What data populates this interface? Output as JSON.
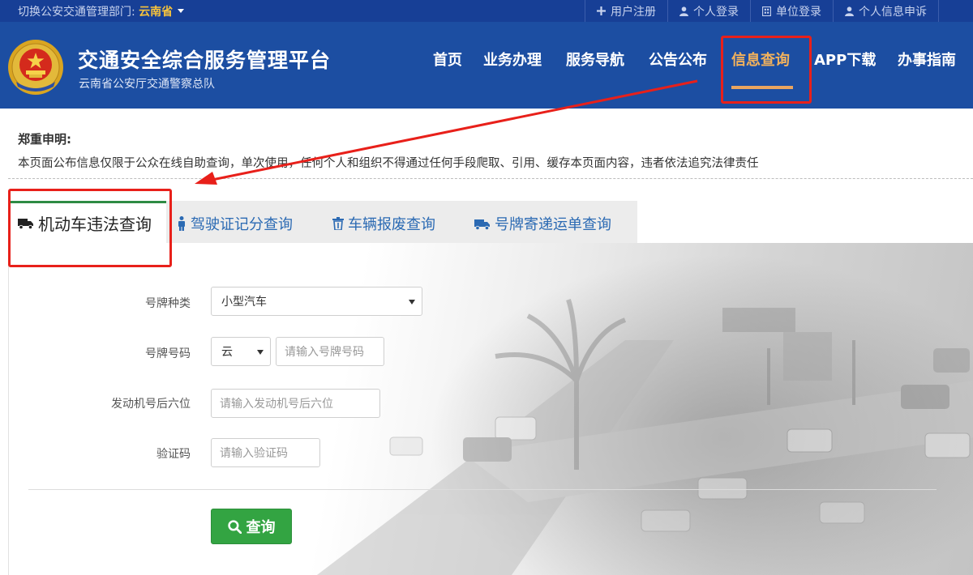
{
  "topbar": {
    "switch_label": "切换公安交通管理部门: ",
    "region": "云南省",
    "links": [
      {
        "label": "用户注册",
        "icon": "plus-icon"
      },
      {
        "label": "个人登录",
        "icon": "user-icon"
      },
      {
        "label": "单位登录",
        "icon": "building-icon"
      },
      {
        "label": "个人信息申诉",
        "icon": "user-icon"
      }
    ]
  },
  "header": {
    "title": "交通安全综合服务管理平台",
    "subtitle": "云南省公安厅交通警察总队",
    "emblem_icon": "police-emblem-icon"
  },
  "nav": {
    "items": [
      "首页",
      "业务办理",
      "服务导航",
      "公告公布",
      "信息查询",
      "APP下载",
      "办事指南"
    ],
    "active": "信息查询"
  },
  "notice": {
    "title": "郑重申明:",
    "text": "本页面公布信息仅限于公众在线自助查询，单次使用，任何个人和组织不得通过任何手段爬取、引用、缓存本页面内容，违者依法追究法律责任"
  },
  "tabs": [
    {
      "label": "机动车违法查询",
      "icon": "truck-icon",
      "active": true
    },
    {
      "label": "驾驶证记分查询",
      "icon": "person-icon",
      "active": false
    },
    {
      "label": "车辆报废查询",
      "icon": "trash-icon",
      "active": false
    },
    {
      "label": "号牌寄递运单查询",
      "icon": "truck-icon",
      "active": false
    }
  ],
  "form": {
    "plate_type": {
      "label": "号牌种类",
      "value": "小型汽车"
    },
    "plate_number": {
      "label": "号牌号码",
      "prefix": "云",
      "placeholder": "请输入号牌号码"
    },
    "engine": {
      "label": "发动机号后六位",
      "placeholder": "请输入发动机号后六位"
    },
    "captcha": {
      "label": "验证码",
      "placeholder": "请输入验证码"
    },
    "submit_label": "查询"
  },
  "colors": {
    "topbar_bg": "#173f96",
    "header_bg": "#1c4ea2",
    "nav_active": "#f2b25c",
    "link_blue": "#2b6ab3",
    "button_green": "#33a442",
    "annotation_red": "#e8201a"
  }
}
